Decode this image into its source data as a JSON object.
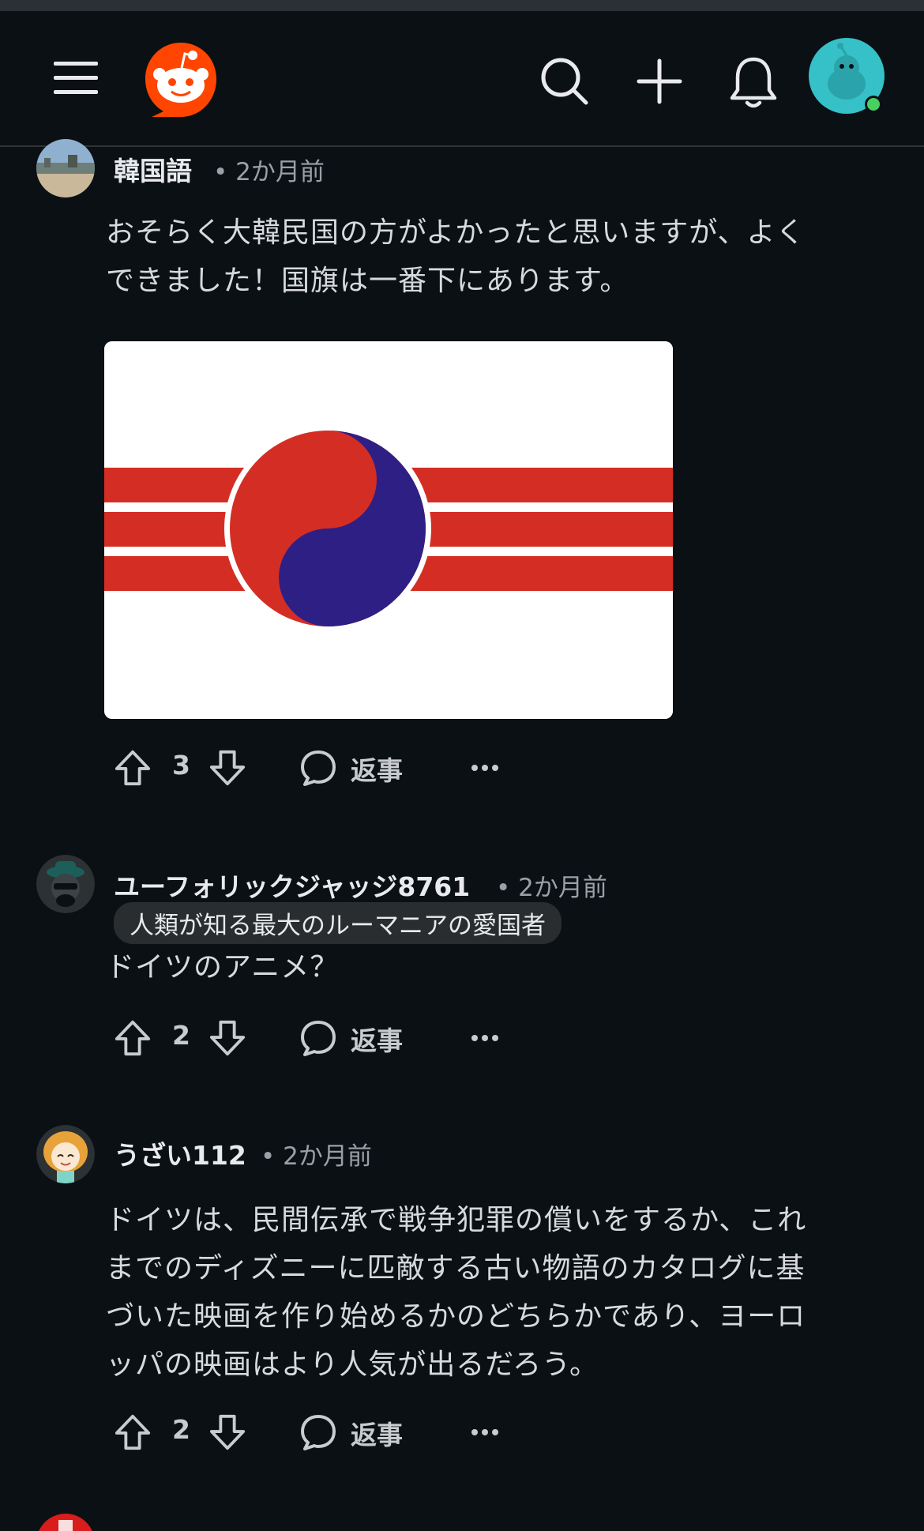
{
  "topbar": {
    "icons": [
      "menu-icon",
      "reddit-logo",
      "search-icon",
      "create-post-icon",
      "notifications-icon",
      "user-avatar"
    ]
  },
  "comments": [
    {
      "user": "韓国語",
      "time": "• 2か月前",
      "body_lines": [
        "おそらく大韓民国の方がよかったと思いますが、よく",
        "できました！国旗は一番下にあります。"
      ],
      "score": "3",
      "reply_label": "返事",
      "has_image": true
    },
    {
      "user": "ユーフォリックジャッジ8761",
      "time": "• 2か月前",
      "flair": "人類が知る最大のルーマニアの愛国者",
      "body_lines": [
        "ドイツのアニメ？"
      ],
      "score": "2",
      "reply_label": "返事"
    },
    {
      "user": "うざい112",
      "time": "• 2か月前",
      "body_lines": [
        "ドイツは、民間伝承で戦争犯罪の償いをするか、これ",
        "までのディズニーに匹敵する古い物語のカタログに基",
        "づいた映画を作り始めるかのどちらかであり、ヨーロ",
        "ッパの映画はより人気が出るだろう。"
      ],
      "score": "2",
      "reply_label": "返事"
    }
  ],
  "colors": {
    "background": "#0b1014",
    "reddit_orange": "#ff4500",
    "flag_red": "#d42e24",
    "flag_blue": "#2e1f85",
    "avatar_teal": "#36c1c8"
  }
}
